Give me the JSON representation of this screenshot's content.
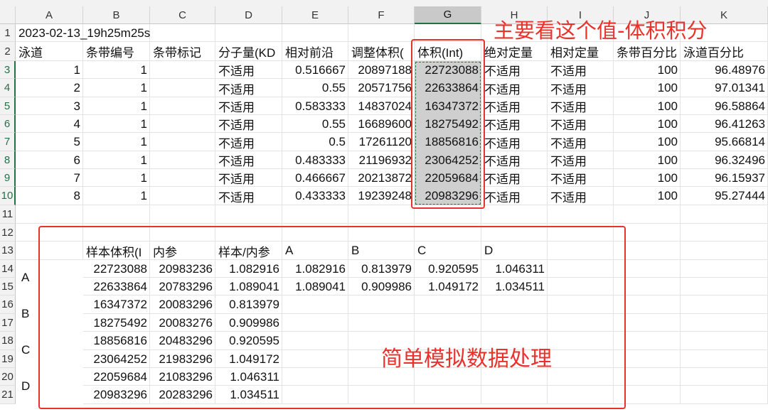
{
  "sheet": {
    "columns": [
      "A",
      "B",
      "C",
      "D",
      "E",
      "F",
      "G",
      "H",
      "I",
      "J",
      "K"
    ],
    "selected_column": "G",
    "rows": [
      "1",
      "2",
      "3",
      "4",
      "5",
      "6",
      "7",
      "8",
      "9",
      "10",
      "11",
      "12",
      "13",
      "14",
      "15",
      "16",
      "17",
      "18",
      "19",
      "20",
      "21"
    ]
  },
  "top": {
    "title": "2023-02-13_19h25m25s",
    "headers": [
      "泳道",
      "条带编号",
      "条带标记",
      "分子量(KD",
      "相对前沿",
      "调整体积(",
      "体积(Int)",
      "绝对定量",
      "相对定量",
      "条带百分比",
      "泳道百分比"
    ],
    "rows": [
      [
        "1",
        "1",
        "",
        "不适用",
        "0.516667",
        "20897188",
        "22723088",
        "不适用",
        "不适用",
        "100",
        "96.48976"
      ],
      [
        "2",
        "1",
        "",
        "不适用",
        "0.55",
        "20571756",
        "22633864",
        "不适用",
        "不适用",
        "100",
        "97.01341"
      ],
      [
        "3",
        "1",
        "",
        "不适用",
        "0.583333",
        "14837024",
        "16347372",
        "不适用",
        "不适用",
        "100",
        "96.58864"
      ],
      [
        "4",
        "1",
        "",
        "不适用",
        "0.55",
        "16689600",
        "18275492",
        "不适用",
        "不适用",
        "100",
        "96.41263"
      ],
      [
        "5",
        "1",
        "",
        "不适用",
        "0.5",
        "17261120",
        "18856816",
        "不适用",
        "不适用",
        "100",
        "95.66814"
      ],
      [
        "6",
        "1",
        "",
        "不适用",
        "0.483333",
        "21196932",
        "23064252",
        "不适用",
        "不适用",
        "100",
        "96.32496"
      ],
      [
        "7",
        "1",
        "",
        "不适用",
        "0.466667",
        "20213872",
        "22059684",
        "不适用",
        "不适用",
        "100",
        "96.15937"
      ],
      [
        "8",
        "1",
        "",
        "不适用",
        "0.433333",
        "19239248",
        "20983296",
        "不适用",
        "不适用",
        "100",
        "95.27444"
      ]
    ]
  },
  "bottom": {
    "headers": [
      "样本体积(I",
      "内参",
      "样本/内参"
    ],
    "groups": [
      "A",
      "B",
      "C",
      "D"
    ],
    "rows": [
      [
        "22723088",
        "20983236",
        "1.082916"
      ],
      [
        "22633864",
        "20783296",
        "1.089041"
      ],
      [
        "16347372",
        "20083296",
        "0.813979"
      ],
      [
        "18275492",
        "20083276",
        "0.909986"
      ],
      [
        "18856816",
        "20483296",
        "0.920595"
      ],
      [
        "23064252",
        "21983296",
        "1.049172"
      ],
      [
        "22059684",
        "21083296",
        "1.046311"
      ],
      [
        "20983296",
        "20283296",
        "1.034511"
      ]
    ],
    "summary_headers": [
      "A",
      "B",
      "C",
      "D"
    ],
    "summary_rows": [
      [
        "1.082916",
        "0.813979",
        "0.920595",
        "1.046311"
      ],
      [
        "1.089041",
        "0.909986",
        "1.049172",
        "1.034511"
      ]
    ]
  },
  "annotations": {
    "top_note": "主要看这个值-体积积分",
    "bottom_note": "简单模拟数据处理",
    "color": "#e8332d"
  },
  "colors": {
    "selection": "#217346",
    "selected_fill": "#cfcfcf",
    "header_bg": "#f2f2f2"
  }
}
